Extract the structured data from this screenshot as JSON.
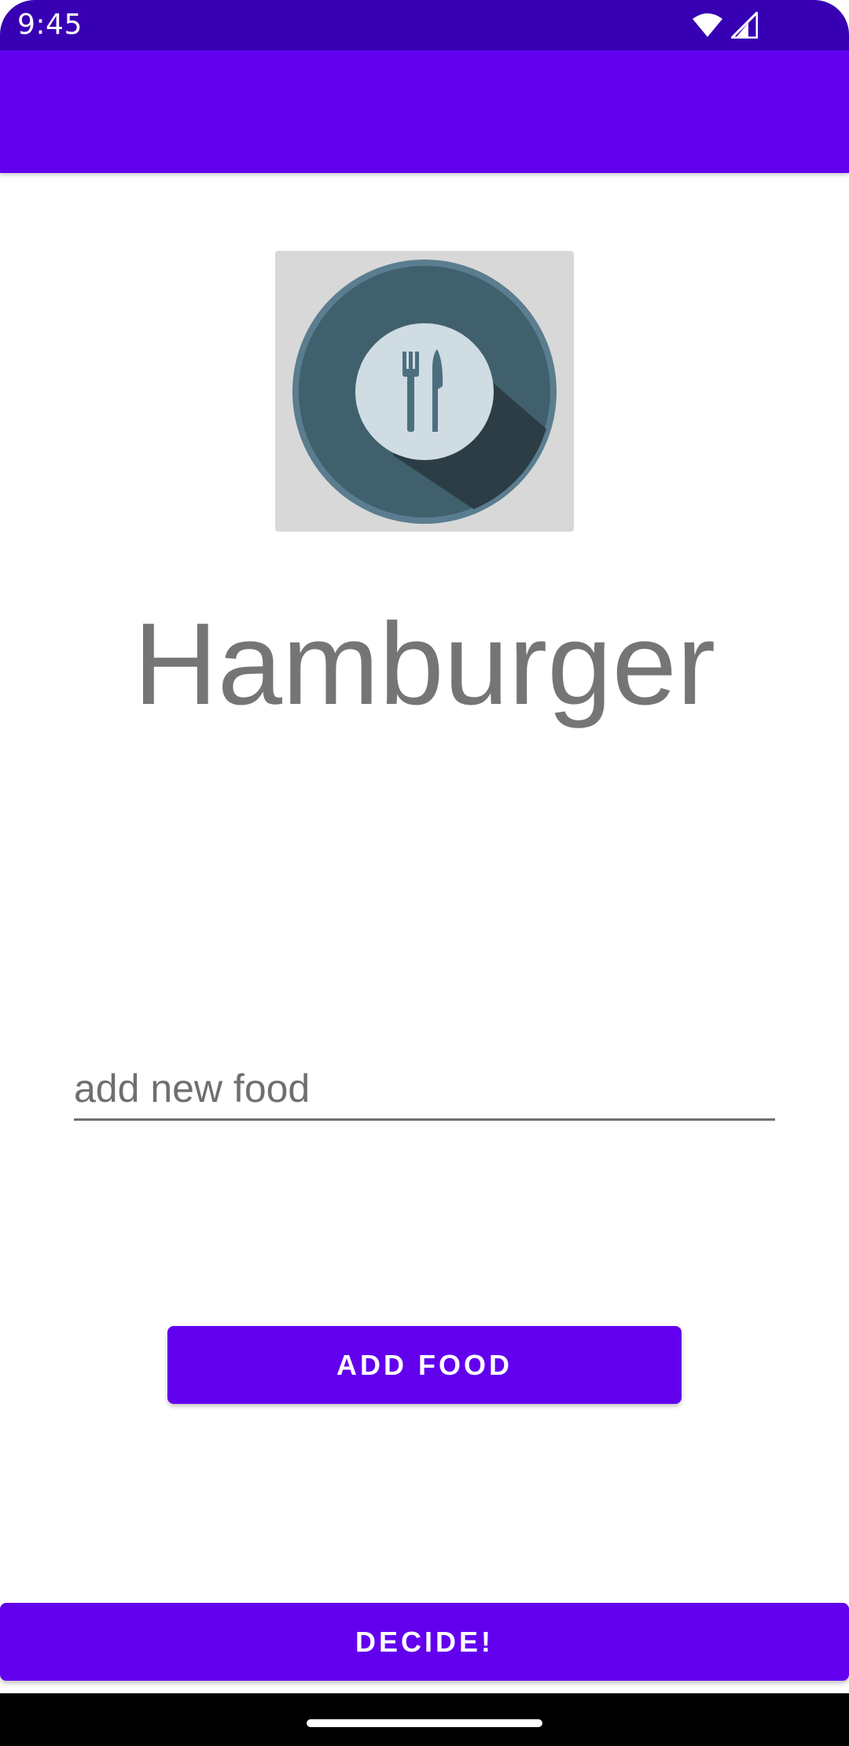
{
  "status_bar": {
    "time": "9:45",
    "icons": [
      "wifi-icon",
      "cell-signal-icon"
    ],
    "color": "#3700B3"
  },
  "app_bar": {
    "color": "#6200EE"
  },
  "food_image": {
    "icon": "fork-knife-plate-icon",
    "background": "#d8d8d8"
  },
  "food": {
    "current": "Hamburger"
  },
  "add_food_input": {
    "value": "",
    "placeholder": "add new food"
  },
  "buttons": {
    "add_food": "ADD FOOD",
    "decide": "DECIDE!",
    "color": "#6200EE"
  },
  "nav_bar": {
    "icon": "home-handle-icon"
  }
}
